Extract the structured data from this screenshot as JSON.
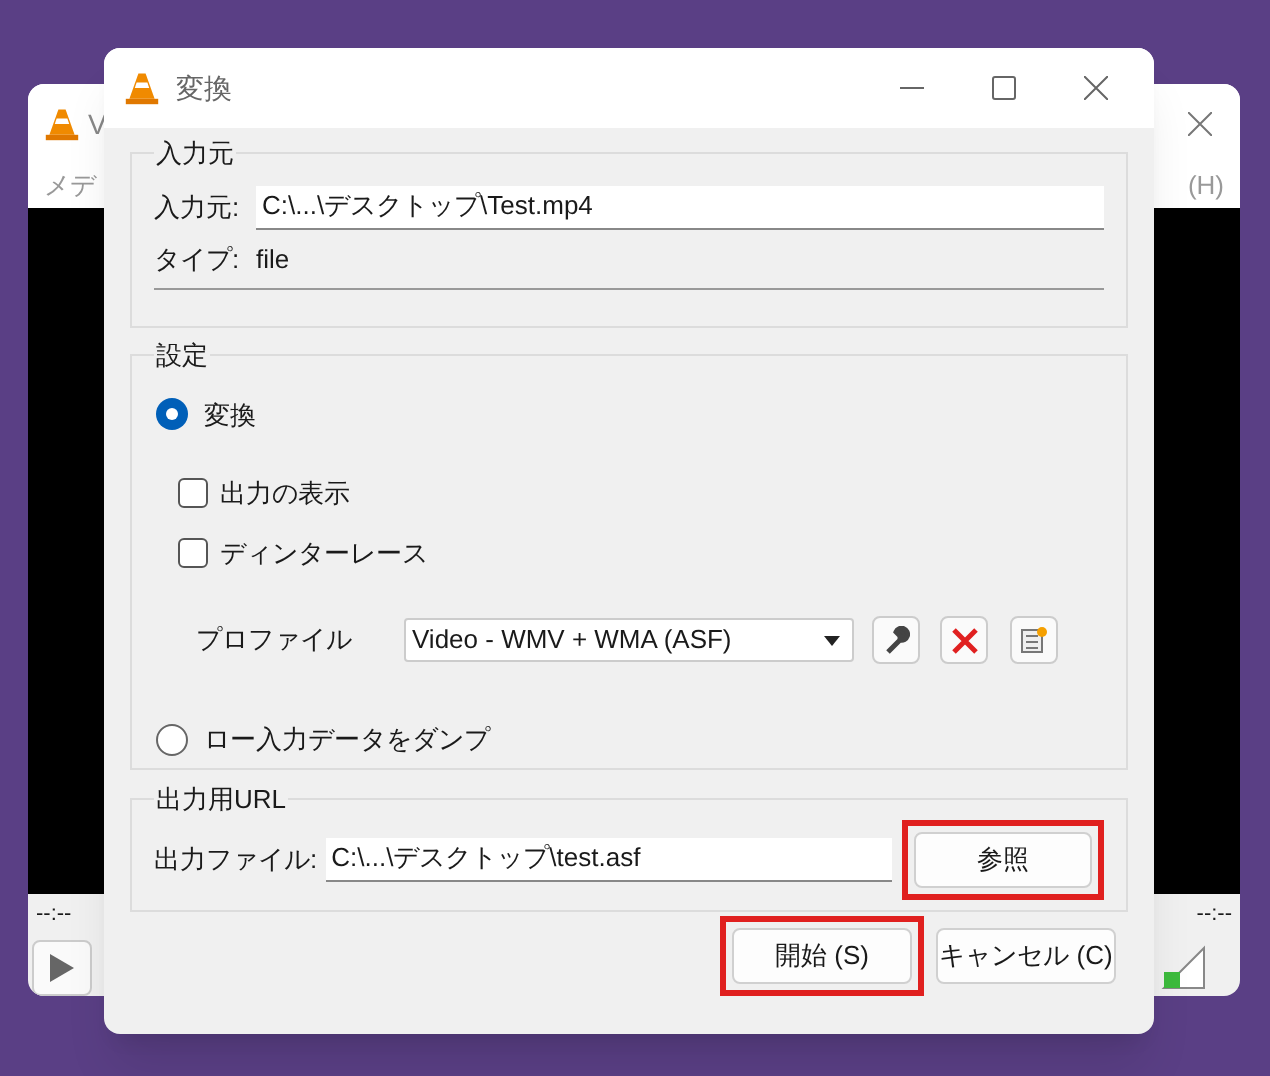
{
  "background_window": {
    "title": "V",
    "menu_left": "メデ",
    "menu_right": "(H)",
    "time_left": "--:--",
    "time_right": "--:--"
  },
  "dialog": {
    "title": "変換"
  },
  "source": {
    "legend": "入力元",
    "source_label": "入力元:",
    "source_value": "C:\\...\\デスクトップ\\Test.mp4",
    "type_label": "タイプ:",
    "type_value": "file"
  },
  "settings": {
    "legend": "設定",
    "convert_radio": {
      "label": "変換",
      "selected": true
    },
    "checkboxes": [
      {
        "label": "出力の表示",
        "checked": false
      },
      {
        "label": "ディンターレース",
        "checked": false
      }
    ],
    "profile_label": "プロファイル",
    "profile_value": "Video - WMV + WMA (ASF)",
    "dump_radio": {
      "label": "ロー入力データをダンプ",
      "selected": false
    }
  },
  "output": {
    "legend": "出力用URL",
    "label": "出力ファイル:",
    "value": "C:\\...\\デスクトップ\\test.asf",
    "browse_button": {
      "label": "参照",
      "highlighted": true
    }
  },
  "buttons": [
    {
      "label": "開始 (S)",
      "highlighted": true
    },
    {
      "label": "キャンセル (C)",
      "highlighted": false
    }
  ]
}
